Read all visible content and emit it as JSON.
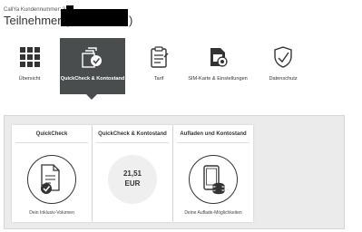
{
  "header": {
    "account_label": "CallYa Kundennummer: 3",
    "title_prefix": "Teilnehmer (0",
    "title_suffix": ")"
  },
  "nav": {
    "items": [
      {
        "label": "Übersicht",
        "icon": "grid-icon"
      },
      {
        "label": "QuickCheck & Kontostand",
        "icon": "quickcheck-document-icon",
        "active": true
      },
      {
        "label": "Tarif",
        "icon": "tariff-clipboard-icon"
      },
      {
        "label": "SIM-Karte & Einstellungen",
        "icon": "sim-card-gear-icon"
      },
      {
        "label": "Datenschutz",
        "icon": "shield-check-icon"
      }
    ]
  },
  "cards": [
    {
      "title": "QuickCheck",
      "footer": "Dein Inklusiv-Volumen",
      "icon": "document-check-icon"
    },
    {
      "title": "QuickCheck & Kontostand",
      "balance_amount": "21,51",
      "balance_currency": "EUR"
    },
    {
      "title": "Aufladen und Kontostand",
      "footer": "Deine Auflade-Möglichkeiten",
      "icon": "phone-coins-icon"
    }
  ],
  "colors": {
    "active_nav_bg": "#4a4d4e",
    "panel_bg": "#ebebeb",
    "text": "#333333"
  }
}
